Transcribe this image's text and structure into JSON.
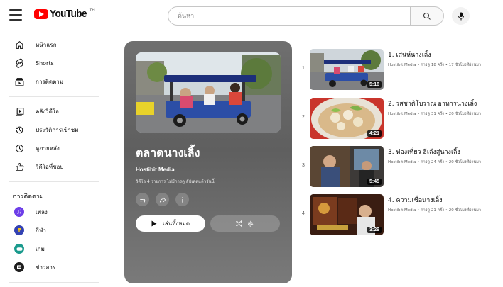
{
  "header": {
    "logo_text": "YouTube",
    "region": "TH",
    "search_placeholder": "ค้นหา"
  },
  "sidebar": {
    "main_items": [
      {
        "label": "หน้าแรก",
        "icon": "home-icon"
      },
      {
        "label": "Shorts",
        "icon": "shorts-icon"
      },
      {
        "label": "การติดตาม",
        "icon": "subscriptions-icon"
      }
    ],
    "library_items": [
      {
        "label": "คลังวิดีโอ",
        "icon": "library-icon"
      },
      {
        "label": "ประวัติการเข้าชม",
        "icon": "history-icon"
      },
      {
        "label": "ดูภายหลัง",
        "icon": "watch-later-icon"
      },
      {
        "label": "วิดีโอที่ชอบ",
        "icon": "liked-icon"
      }
    ],
    "subscriptions_title": "การติดตาม",
    "subscriptions": [
      {
        "label": "เพลง",
        "icon": "music-icon",
        "color": "#6d3ee8"
      },
      {
        "label": "กีฬา",
        "icon": "sports-icon",
        "color": "#3342b3"
      },
      {
        "label": "เกม",
        "icon": "gaming-icon",
        "color": "#1a9a8d"
      },
      {
        "label": "ข่าวสาร",
        "icon": "news-icon",
        "color": "#1f1f1f"
      }
    ]
  },
  "playlist": {
    "title": "ตลาดนางเลิ้ง",
    "owner": "Hostibit Media",
    "meta": "วิดีโอ 4 รายการ  ไม่มีการดู  อัปเดตแล้ววันนี้",
    "play_all_label": "เล่นทั้งหมด",
    "shuffle_label": "สุ่ม"
  },
  "videos": [
    {
      "index": "1",
      "title": "1. เสน่ห์นางเลิ้ง",
      "meta": "Hostibit Media • การดู 18 ครั้ง • 17 ชั่วโมงที่ผ่านมา",
      "duration": "5:18"
    },
    {
      "index": "2",
      "title": "2. รสชาติโบราณ อาหารนางเลิ้ง",
      "meta": "Hostibit Media • การดู 31 ครั้ง • 20 ชั่วโมงที่ผ่านมา",
      "duration": "4:21"
    },
    {
      "index": "3",
      "title": "3. ท่องเที่ยว ฮีเล้งสู่นางเลิ้ง",
      "meta": "Hostibit Media • การดู 24 ครั้ง • 20 ชั่วโมงที่ผ่านมา",
      "duration": "5:45"
    },
    {
      "index": "4",
      "title": "4. ความเชื่อนางเลิ้ง",
      "meta": "Hostibit Media • การดู 21 ครั้ง • 20 ชั่วโมงที่ผ่านมา",
      "duration": "3:29"
    }
  ],
  "colors": {
    "brand_red": "#ff0000",
    "panel_gray": "#676767"
  }
}
